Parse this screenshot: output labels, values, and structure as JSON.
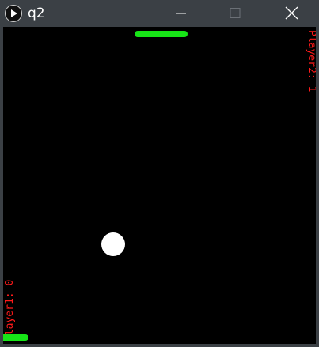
{
  "window": {
    "title": "q2",
    "titlebar_color": "#3b4045"
  },
  "titlebar_icons": {
    "app": "play-icon",
    "minimize": "minimize-icon",
    "maximize": "maximize-icon",
    "close": "close-icon"
  },
  "game": {
    "background_color": "#000000",
    "paddle_color": "#17e517",
    "ball_color": "#ffffff",
    "score_color": "#ff1a1a",
    "player2_score_label": "Player2: 1",
    "player1_score_label": "Player1: 0"
  }
}
